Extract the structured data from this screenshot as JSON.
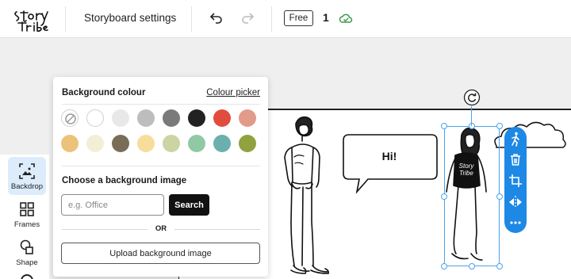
{
  "header": {
    "logo_alt": "Story Tribe",
    "title": "Storyboard settings",
    "undo_icon": "undo-icon",
    "redo_icon": "redo-icon",
    "plan": "Free",
    "page_count": "1",
    "sync_icon": "cloud-check-icon"
  },
  "sidebar": {
    "items": [
      {
        "label": "Backdrop",
        "icon": "backdrop-icon",
        "active": true
      },
      {
        "label": "Frames",
        "icon": "grid-icon",
        "active": false
      },
      {
        "label": "Shape",
        "icon": "shape-icon",
        "active": false
      }
    ]
  },
  "panel": {
    "heading": "Background colour",
    "picker_link": "Colour picker",
    "swatches": [
      "none",
      "#ffffff",
      "#e8e8e8",
      "#bdbdbd",
      "#7a7a7a",
      "#222222",
      "#e24c3f",
      "#e29a8a",
      "#ecc27a",
      "#f1efd6",
      "#7a6d58",
      "#f7dd9b",
      "#cdd4a4",
      "#91c9a5",
      "#6bb0ad",
      "#90a23e"
    ],
    "image_heading": "Choose a background image",
    "search_placeholder": "e.g. Office",
    "search_button": "Search",
    "or_label": "OR",
    "upload_button": "Upload background image"
  },
  "canvas": {
    "speech_text": "Hi!",
    "rotate_icon": "rotate-icon",
    "element_tools": [
      "walk-icon",
      "trash-icon",
      "crop-icon",
      "flip-icon",
      "more-icon"
    ]
  }
}
